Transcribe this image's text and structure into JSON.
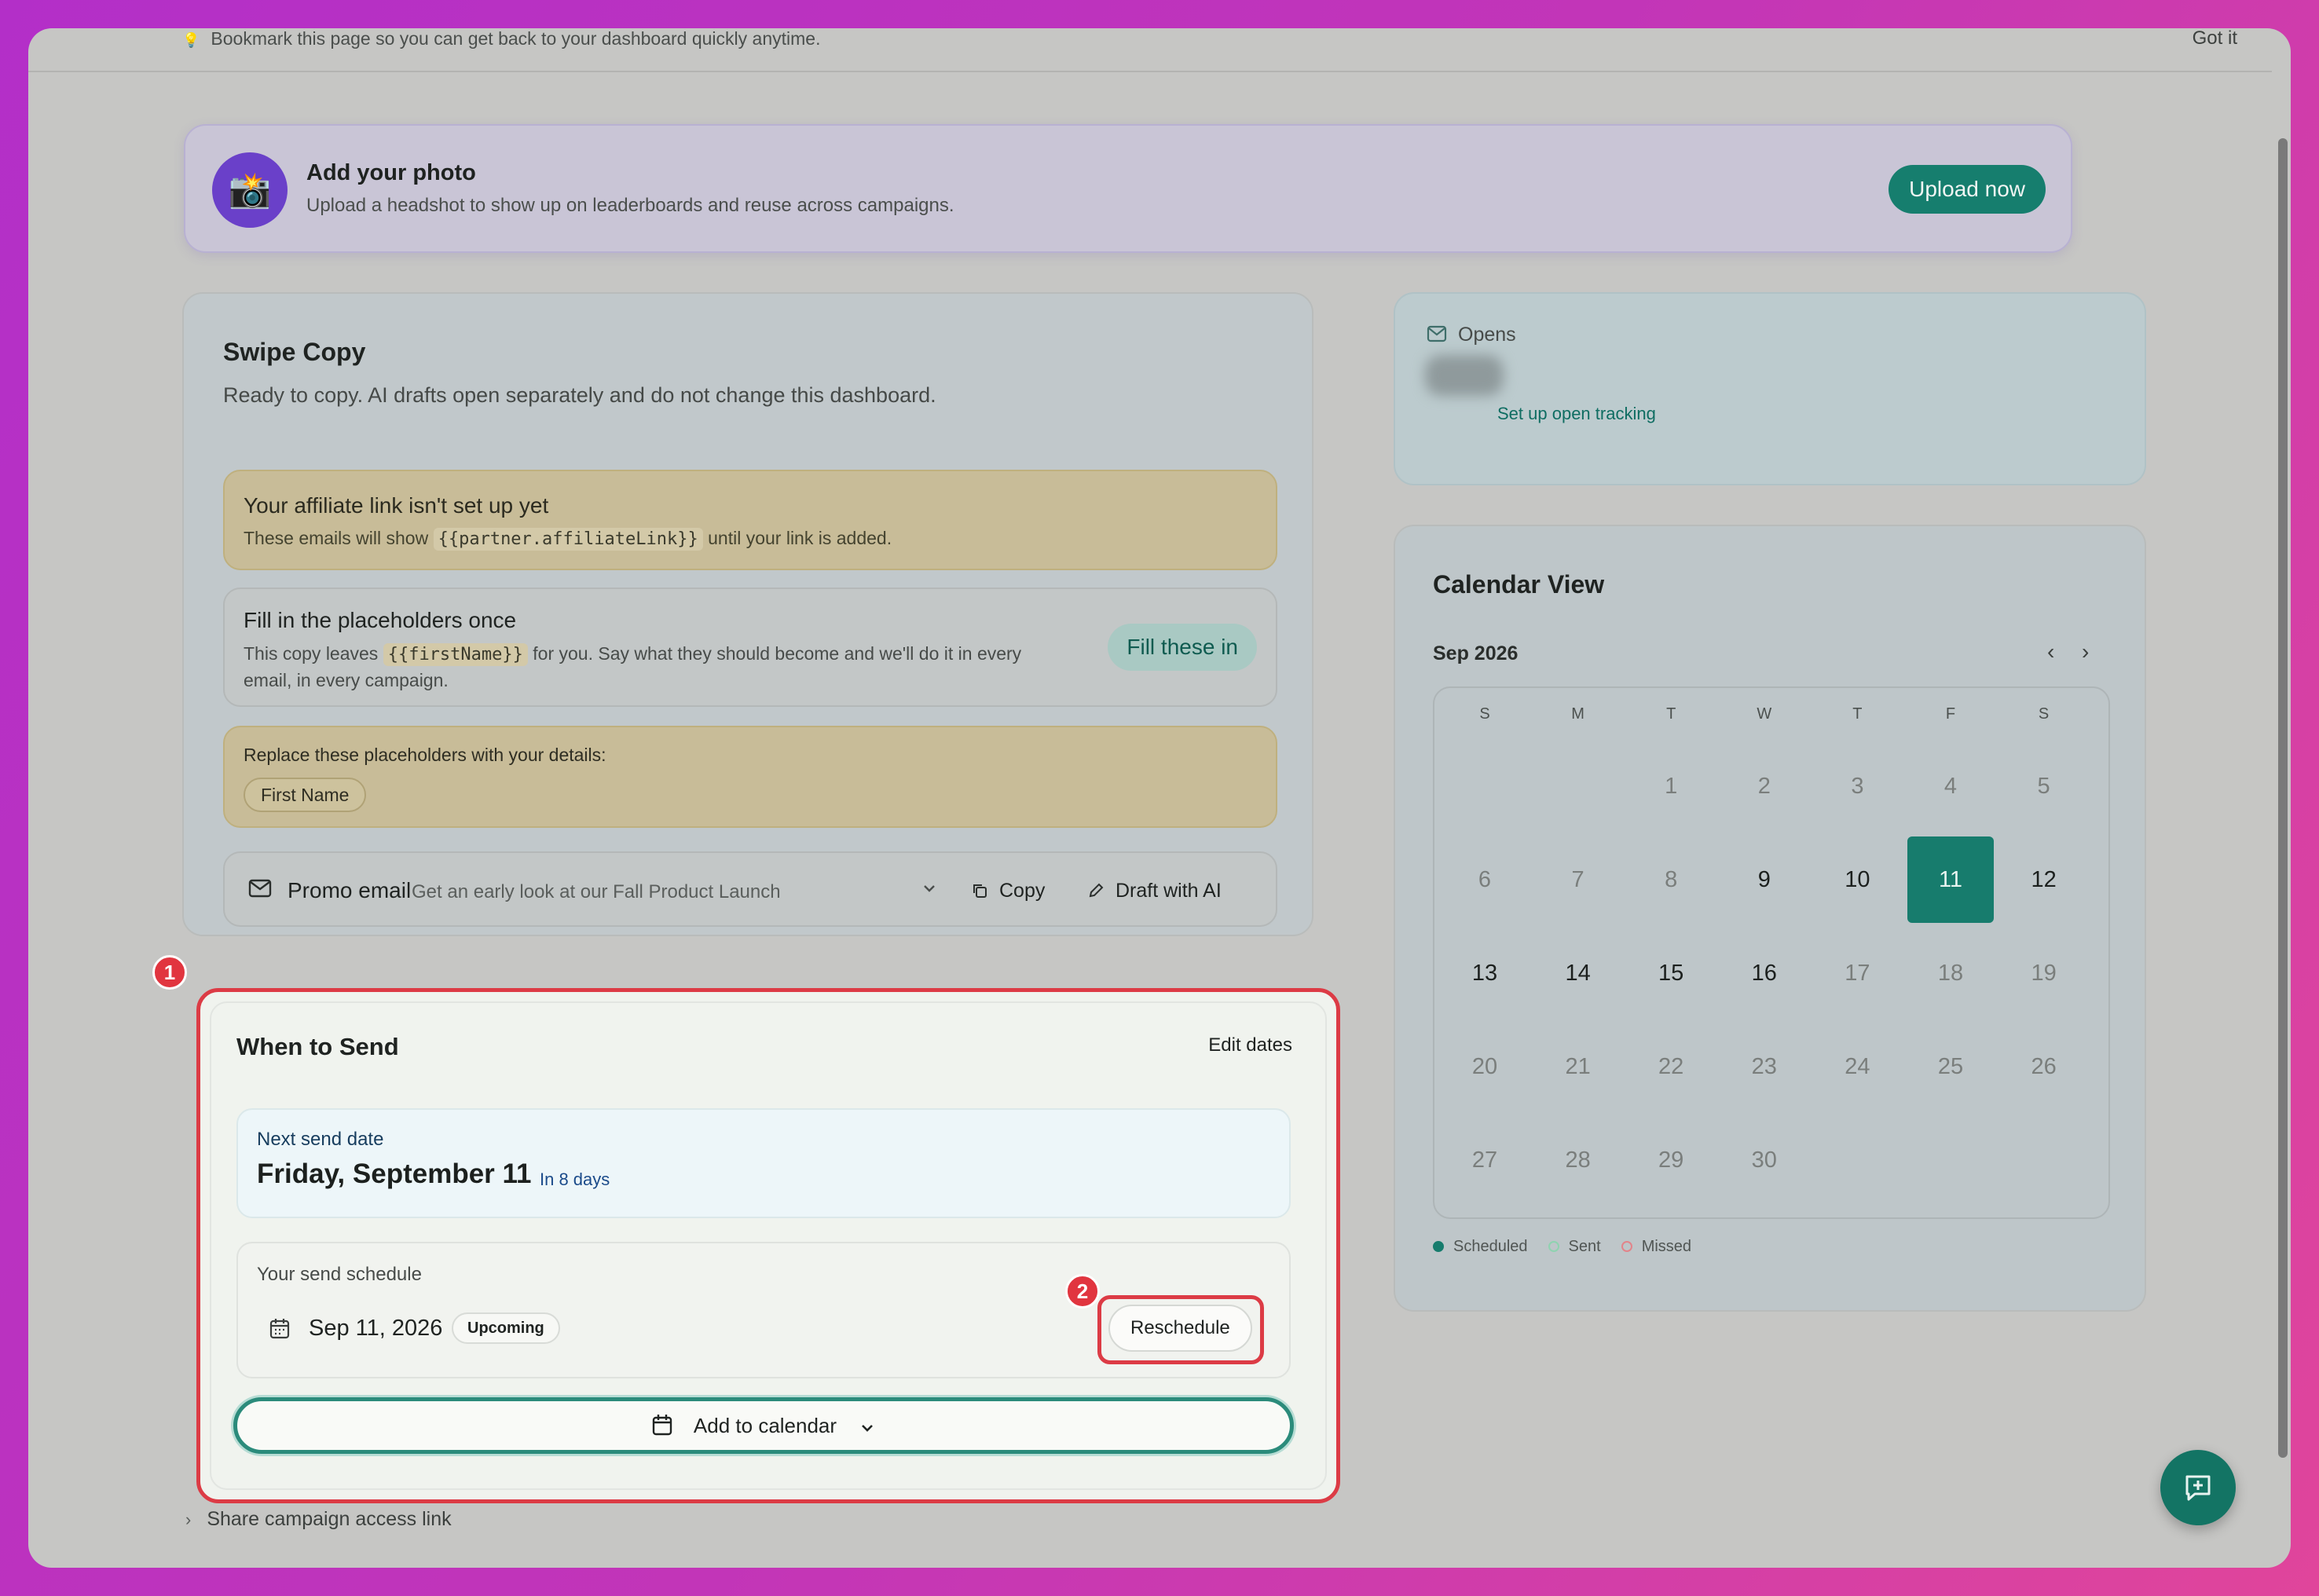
{
  "tipbar": {
    "icon": "lightbulb-icon",
    "text": "Bookmark this page so you can get back to your dashboard quickly anytime.",
    "dismiss": "Got it"
  },
  "photo": {
    "title": "Add your photo",
    "subtitle": "Upload a headshot to show up on leaderboards and reuse across campaigns.",
    "button": "Upload now",
    "icon": "camera-icon"
  },
  "swipe": {
    "title": "Swipe Copy",
    "desc": "Ready to copy. AI drafts open separately and do not change this dashboard.",
    "affiliate": {
      "title": "Your affiliate link isn't set up yet",
      "pre": "These emails will show",
      "code": "{{partner.affiliateLink}}",
      "post": "until your link is added."
    },
    "fill": {
      "title": "Fill in the placeholders once",
      "pre": "This copy leaves",
      "code": "{{firstName}}",
      "post": "for you. Say what they should become and we'll do it in every email, in every campaign.",
      "button": "Fill these in"
    },
    "replace": {
      "title": "Replace these placeholders with your details:",
      "chip": "First Name"
    },
    "promo": {
      "label": "Promo email",
      "subject": "Get an early look at our Fall Product Launch",
      "copy": "Copy",
      "draft": "Draft with AI"
    }
  },
  "opens": {
    "label": "Opens",
    "link": "Set up open tracking"
  },
  "calendar": {
    "title": "Calendar View",
    "month": "Sep 2026",
    "weekdays": [
      "S",
      "M",
      "T",
      "W",
      "T",
      "F",
      "S"
    ],
    "days": [
      "1",
      "2",
      "3",
      "4",
      "5",
      "6",
      "7",
      "8",
      "9",
      "10",
      "11",
      "12",
      "13",
      "14",
      "15",
      "16",
      "17",
      "18",
      "19",
      "20",
      "21",
      "22",
      "23",
      "24",
      "25",
      "26",
      "27",
      "28",
      "29",
      "30"
    ],
    "first_weekday": 2,
    "selected_day": 11,
    "active_days": [
      9,
      10,
      11,
      12,
      13,
      14,
      15,
      16
    ],
    "legend": [
      {
        "label": "Scheduled",
        "color": "#177c6d"
      },
      {
        "label": "Sent",
        "color": "#8fd3b0"
      },
      {
        "label": "Missed",
        "color": "#e2848a"
      }
    ]
  },
  "when": {
    "title": "When to Send",
    "edit": "Edit dates",
    "next_label": "Next send date",
    "next_date": "Friday, September 11",
    "in_days": "In 8 days",
    "schedule_label": "Your send schedule",
    "schedule_date": "Sep 11, 2026",
    "badge": "Upcoming",
    "reschedule": "Reschedule",
    "add_calendar": "Add to calendar"
  },
  "markers": [
    "1",
    "2"
  ],
  "share": "Share campaign access link",
  "colors": {
    "accent": "#177c6d",
    "highlight": "#dc3b45"
  }
}
